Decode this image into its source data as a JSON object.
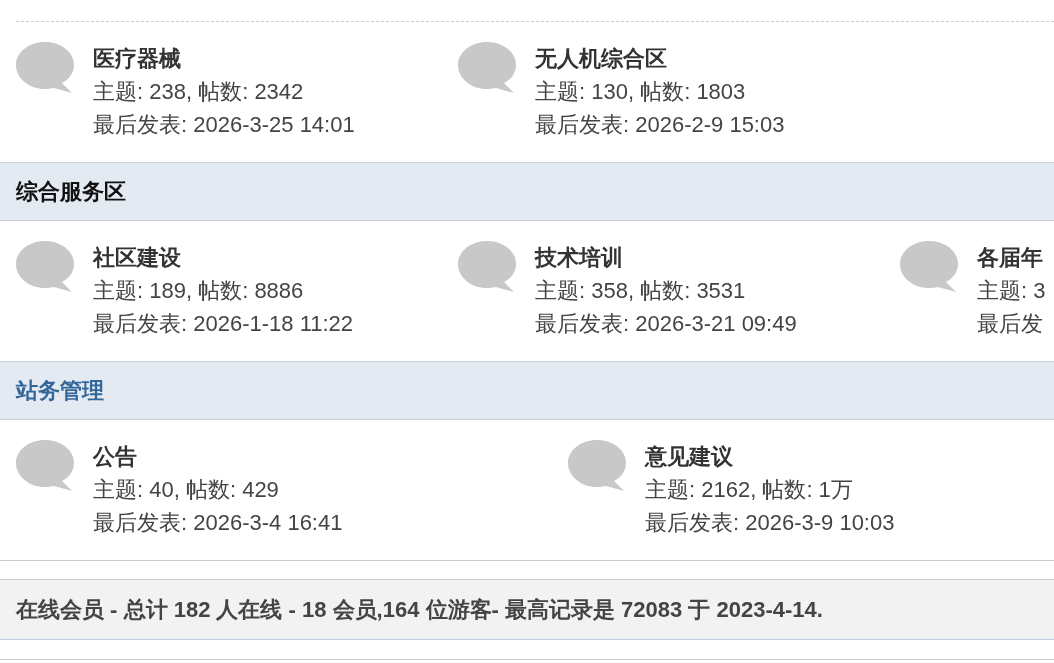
{
  "sections": [
    {
      "forums": [
        {
          "name": "医疗器械",
          "stats": "主题: 238, 帖数: 2342",
          "last_post": "最后发表: 2026-3-25 14:01"
        },
        {
          "name": "无人机综合区",
          "stats": "主题: 130, 帖数: 1803",
          "last_post": "最后发表: 2026-2-9 15:03"
        }
      ]
    },
    {
      "title": "综合服务区",
      "color": "#111111",
      "forums": [
        {
          "name": "社区建设",
          "stats": "主题: 189, 帖数: 8886",
          "last_post": "最后发表: 2026-1-18 11:22"
        },
        {
          "name": "技术培训",
          "stats": "主题: 358, 帖数: 3531",
          "last_post": "最后发表: 2026-3-21 09:49"
        },
        {
          "name": "各届年",
          "stats": "主题: 3",
          "last_post": "最后发"
        }
      ]
    },
    {
      "title": "站务管理",
      "color": "#336699",
      "forums": [
        {
          "name": "公告",
          "stats": "主题: 40, 帖数: 429",
          "last_post": "最后发表: 2026-3-4 16:41"
        },
        {
          "name": "意见建议",
          "stats": "主题: 2162, 帖数: 1万",
          "last_post": "最后发表: 2026-3-9 10:03"
        }
      ]
    }
  ],
  "online_bar": {
    "text": "在线会员 - 总计 182 人在线 - 18 会员,164 位游客- 最高记录是 72083 于 2023-4-14."
  }
}
